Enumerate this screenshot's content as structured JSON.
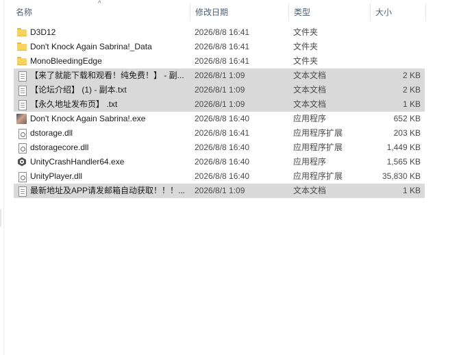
{
  "header": {
    "name": "名称",
    "date": "修改日期",
    "type": "类型",
    "size": "大小"
  },
  "files": [
    {
      "name": "D3D12",
      "date": "2026/8/8 16:41",
      "type": "文件夹",
      "size": "",
      "icon": "folder-icon",
      "selected": false
    },
    {
      "name": "Don't Knock Again Sabrina!_Data",
      "date": "2026/8/8 16:41",
      "type": "文件夹",
      "size": "",
      "icon": "folder-icon",
      "selected": false
    },
    {
      "name": "MonoBleedingEdge",
      "date": "2026/8/8 16:41",
      "type": "文件夹",
      "size": "",
      "icon": "folder-icon",
      "selected": false
    },
    {
      "name": "【来了就能下载和观看！纯免费！】 - 副...",
      "date": "2026/8/1 1:09",
      "type": "文本文档",
      "size": "2 KB",
      "icon": "text-file-icon",
      "selected": true
    },
    {
      "name": "【论坛介绍】 (1) - 副本.txt",
      "date": "2026/8/1 1:09",
      "type": "文本文档",
      "size": "2 KB",
      "icon": "text-file-icon",
      "selected": true
    },
    {
      "name": "【永久地址发布页】 .txt",
      "date": "2026/8/1 1:09",
      "type": "文本文档",
      "size": "1 KB",
      "icon": "text-file-icon",
      "selected": true
    },
    {
      "name": "Don't Knock Again Sabrina!.exe",
      "date": "2026/8/8 16:40",
      "type": "应用程序",
      "size": "652 KB",
      "icon": "game-exe-icon",
      "selected": false
    },
    {
      "name": "dstorage.dll",
      "date": "2026/8/8 16:41",
      "type": "应用程序扩展",
      "size": "203 KB",
      "icon": "dll-file-icon",
      "selected": false
    },
    {
      "name": "dstoragecore.dll",
      "date": "2026/8/8 16:40",
      "type": "应用程序扩展",
      "size": "1,449 KB",
      "icon": "dll-file-icon",
      "selected": false
    },
    {
      "name": "UnityCrashHandler64.exe",
      "date": "2026/8/8 16:40",
      "type": "应用程序",
      "size": "1,565 KB",
      "icon": "unity-exe-icon",
      "selected": false
    },
    {
      "name": "UnityPlayer.dll",
      "date": "2026/8/8 16:40",
      "type": "应用程序扩展",
      "size": "35,830 KB",
      "icon": "dll-file-icon",
      "selected": false
    },
    {
      "name": "最新地址及APP请发邮箱自动获取！！！...",
      "date": "2026/8/1 1:09",
      "type": "文本文档",
      "size": "1 KB",
      "icon": "text-file-icon",
      "selected": true
    }
  ]
}
